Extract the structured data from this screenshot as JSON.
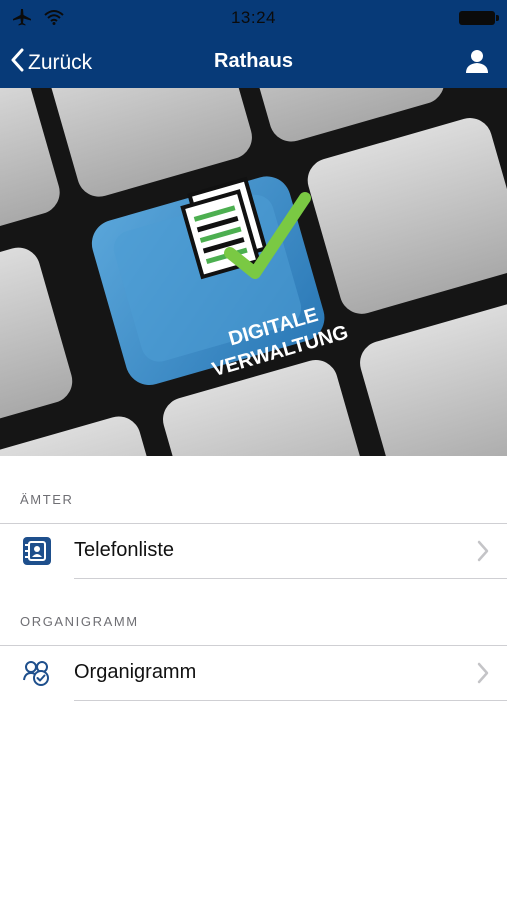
{
  "status_bar": {
    "time": "13:24",
    "icons": [
      "airplane-icon",
      "wifi-icon",
      "battery-icon"
    ]
  },
  "nav": {
    "back_label": "Zurück",
    "title": "Rathaus",
    "user_icon": "user-icon"
  },
  "hero": {
    "line1": "DIGITALE",
    "line2": "VERWALTUNG"
  },
  "sections": [
    {
      "header": "ÄMTER",
      "item": {
        "label": "Telefonliste",
        "icon": "phonebook-icon"
      }
    },
    {
      "header": "ORGANIGRAMM",
      "item": {
        "label": "Organigramm",
        "icon": "org-chart-icon"
      }
    }
  ],
  "colors": {
    "nav": "#073a78",
    "accent": "#1e4f8c",
    "key_blue": "#3f8fc8"
  }
}
